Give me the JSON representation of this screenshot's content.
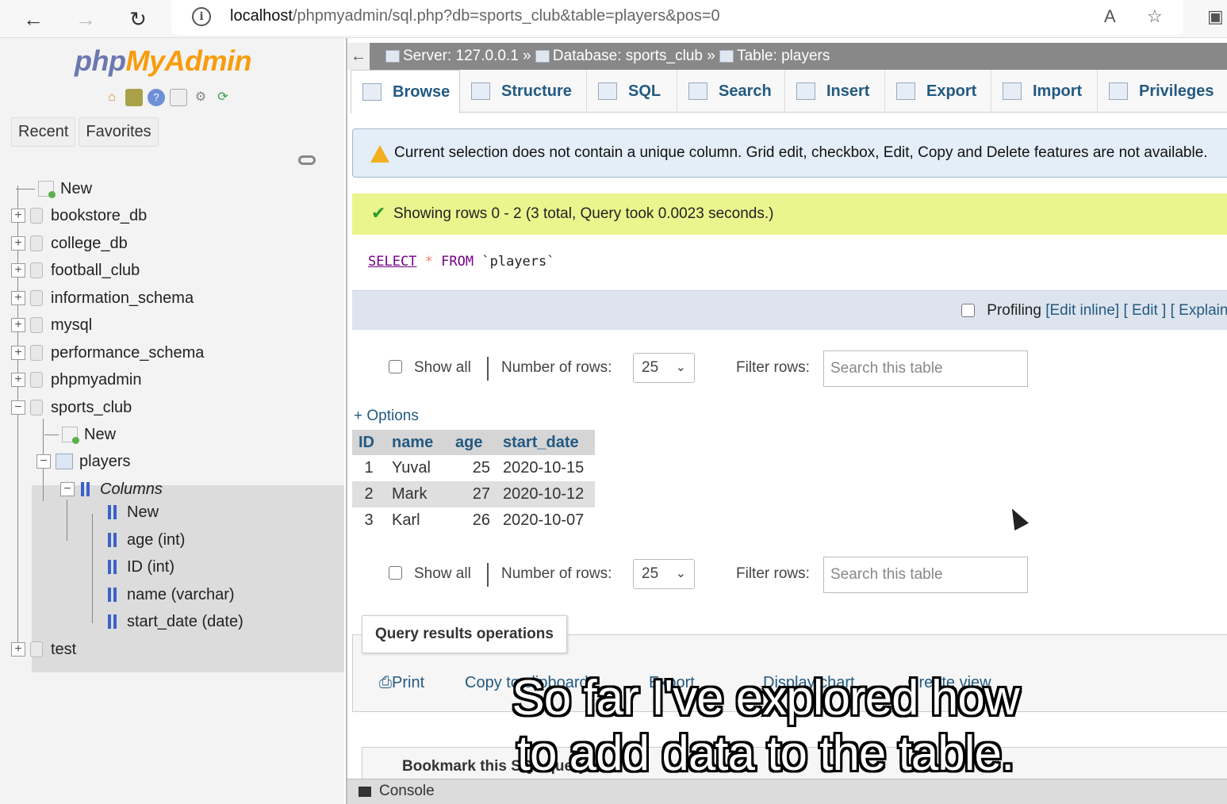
{
  "browser": {
    "url_host": "localhost",
    "url_path": "/phpmyadmin/sql.php?db=sports_club&table=players&pos=0"
  },
  "sidebar": {
    "logo_php": "php",
    "logo_myadmin": "MyAdmin",
    "recent_label": "Recent",
    "favorites_label": "Favorites",
    "tree": [
      {
        "label": "New",
        "kind": "new"
      },
      {
        "label": "bookstore_db",
        "kind": "db"
      },
      {
        "label": "college_db",
        "kind": "db"
      },
      {
        "label": "football_club",
        "kind": "db"
      },
      {
        "label": "information_schema",
        "kind": "db"
      },
      {
        "label": "mysql",
        "kind": "db"
      },
      {
        "label": "performance_schema",
        "kind": "db"
      },
      {
        "label": "phpmyadmin",
        "kind": "db"
      },
      {
        "label": "sports_club",
        "kind": "db-open"
      },
      {
        "label": "New",
        "kind": "new"
      },
      {
        "label": "players",
        "kind": "table"
      },
      {
        "label": "Columns",
        "kind": "columns"
      },
      {
        "label": "New",
        "kind": "col-new"
      },
      {
        "label": "age (int)",
        "kind": "col"
      },
      {
        "label": "ID (int)",
        "kind": "col"
      },
      {
        "label": "name (varchar)",
        "kind": "col"
      },
      {
        "label": "start_date (date)",
        "kind": "col"
      },
      {
        "label": "test",
        "kind": "db"
      }
    ]
  },
  "breadcrumb": {
    "server": "Server: 127.0.0.1",
    "database": "Database: sports_club",
    "table": "Table: players",
    "separator": "»"
  },
  "tabs": [
    "Browse",
    "Structure",
    "SQL",
    "Search",
    "Insert",
    "Export",
    "Import",
    "Privileges"
  ],
  "notice": "Current selection does not contain a unique column. Grid edit, checkbox, Edit, Copy and Delete features are not available.",
  "success": "Showing rows 0 - 2 (3 total, Query took 0.0023 seconds.)",
  "sql": {
    "select": "SELECT",
    "star": "*",
    "from": "FROM",
    "table": "`players`"
  },
  "profiling": {
    "label": "Profiling",
    "edit_inline": "[Edit inline]",
    "edit": "[ Edit ]",
    "explain": "[ Explain"
  },
  "nav": {
    "show_all": "Show all",
    "number_of_rows": "Number of rows:",
    "rows_value": "25",
    "filter_rows": "Filter rows:",
    "search_placeholder": "Search this table"
  },
  "options_label": "+ Options",
  "table": {
    "columns": [
      "ID",
      "name",
      "age",
      "start_date"
    ],
    "rows": [
      [
        "1",
        "Yuval",
        "25",
        "2020-10-15"
      ],
      [
        "2",
        "Mark",
        "27",
        "2020-10-12"
      ],
      [
        "3",
        "Karl",
        "26",
        "2020-10-07"
      ]
    ]
  },
  "query_results": {
    "title": "Query results operations",
    "print": "Print",
    "copy": "Copy to clipboard",
    "export": "Export",
    "display_chart": "Display chart",
    "create_view": "Create view"
  },
  "bookmark": "Bookmark this SQL query",
  "console": "Console",
  "subtitle_line1": "So far I've explored how",
  "subtitle_line2": "to add data to the table."
}
